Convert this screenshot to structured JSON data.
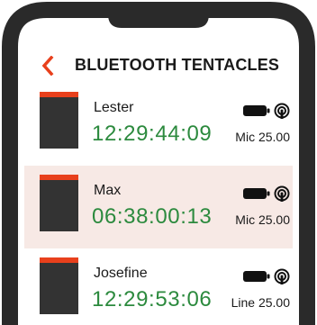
{
  "header": {
    "title": "BLUETOOTH TENTACLES",
    "back_icon": "chevron-left-icon"
  },
  "colors": {
    "accent": "#e8401c",
    "timecode": "#2c8a3e",
    "selected_row": "#f7e9e5",
    "device_body": "#333333"
  },
  "devices": [
    {
      "name": "Lester",
      "timecode": "12:29:44:09",
      "source": "Mic 25.00",
      "selected": false
    },
    {
      "name": "Max",
      "timecode": "06:38:00:13",
      "source": "Mic 25.00",
      "selected": true
    },
    {
      "name": "Josefine",
      "timecode": "12:29:53:06",
      "source": "Line 25.00",
      "selected": false
    }
  ],
  "status_icons": [
    "battery-icon",
    "signal-icon"
  ]
}
